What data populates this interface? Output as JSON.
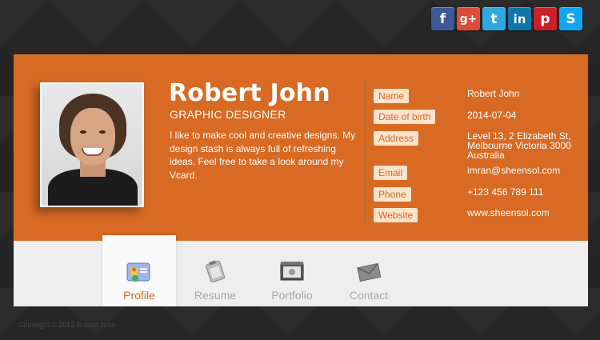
{
  "social": {
    "icons": [
      {
        "name": "facebook-icon",
        "glyph": "f",
        "color": "#3b5998"
      },
      {
        "name": "google-plus-icon",
        "glyph": "g+",
        "color": "#dd4b39"
      },
      {
        "name": "twitter-icon",
        "glyph": "t",
        "color": "#2fa9e1"
      },
      {
        "name": "linkedin-icon",
        "glyph": "in",
        "color": "#0e76a8"
      },
      {
        "name": "pinterest-icon",
        "glyph": "p",
        "color": "#cb2027"
      },
      {
        "name": "skype-icon",
        "glyph": "S",
        "color": "#12a5f4"
      }
    ]
  },
  "profile": {
    "name": "Robert John",
    "title": "GRAPHIC DESIGNER",
    "bio": "I like to make cool and creative designs. My design stash is always full of refreshing ideas. Feel free to take a look around my Vcard."
  },
  "info": [
    {
      "label": "Name",
      "value": "Robert John"
    },
    {
      "label": "Date of birth",
      "value": "2014-07-04"
    },
    {
      "label": "Address",
      "value": "Level 13, 2 Elizabeth St, Melbourne Victoria 3000 Australia"
    },
    {
      "label": "Email",
      "value": "imran@sheensol.com"
    },
    {
      "label": "Phone",
      "value": "+123 456 789 111"
    },
    {
      "label": "Website",
      "value": "www.sheensol.com"
    }
  ],
  "tabs": [
    {
      "label": "Profile",
      "active": true
    },
    {
      "label": "Resume",
      "active": false
    },
    {
      "label": "Portfolio",
      "active": false
    },
    {
      "label": "Contact",
      "active": false
    }
  ],
  "footer": {
    "text": "Copyright © 2012 Robert John"
  },
  "colors": {
    "accent": "#d86a23",
    "label_bg": "#fbe3cc"
  }
}
